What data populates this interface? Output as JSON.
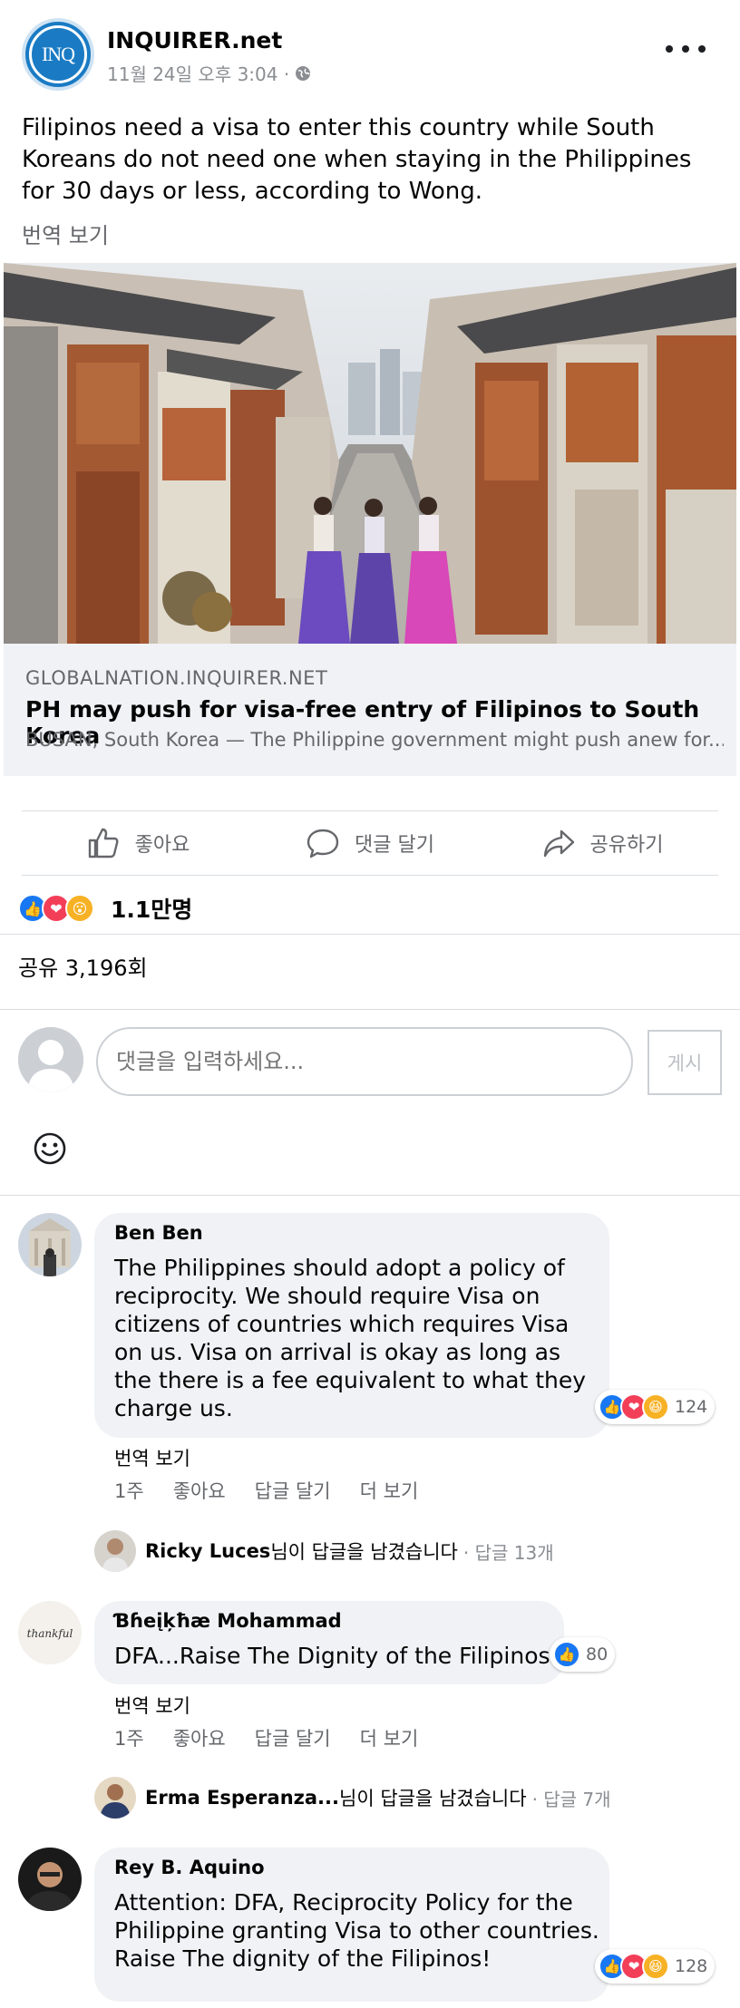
{
  "post": {
    "page_name": "INQUIRER.net",
    "logo_text": "INQ",
    "date": "11월 24일 오후 3:04 ·",
    "text": "Filipinos need a visa to enter this country while South Koreans do not need one when staying in the Philippines for 30 days or less, according to Wong.",
    "translate_label": "번역 보기"
  },
  "link": {
    "domain": "GLOBALNATION.INQUIRER.NET",
    "title": "PH may push for visa-free entry of Filipinos to South Korea",
    "description": "BUSAN, South Korea — The Philippine government might push anew for..."
  },
  "actions": {
    "like": "좋아요",
    "comment": "댓글 달기",
    "share": "공유하기"
  },
  "stats": {
    "reactions": "1.1만명",
    "shares": "공유 3,196회"
  },
  "composer": {
    "placeholder": "댓글을 입력하세요...",
    "post_label": "게시"
  },
  "comments": [
    {
      "author": "Ben Ben",
      "text": "The Philippines should adopt a policy of reciprocity. We should require Visa on citizens of countries which requires Visa on us. Visa on arrival is okay as long as the there is a fee equivalent to what they charge us.",
      "reaction_count": "124",
      "translate": "번역 보기",
      "time": "1주",
      "like": "좋아요",
      "reply": "답글 달기",
      "more": "더 보기",
      "reply_summary": {
        "name": "Ricky Luces",
        "text": "님이 답글을 남겼습니다",
        "meta": "· 답글 13개"
      }
    },
    {
      "author": "Ɓɦeįķħæ Mohammad",
      "text": "DFA...Raise The Dignity of the Filipinos!",
      "reaction_count": "80",
      "translate": "번역 보기",
      "time": "1주",
      "like": "좋아요",
      "reply": "답글 달기",
      "more": "더 보기",
      "avatar_text": "thankful",
      "reply_summary": {
        "name": "Erma Esperanza...",
        "text": "님이 답글을 남겼습니다",
        "meta": "· 답글 7개"
      }
    },
    {
      "author": "Rey B. Aquino",
      "text": "Attention: DFA, Reciprocity Policy for the Philippine granting Visa to other countries. Raise The dignity of the Filipinos!",
      "reaction_count": "128"
    }
  ],
  "colors": {
    "brand_blue": "#1877f2",
    "love_red": "#f33e58",
    "wow_yellow": "#f7b125",
    "muted_text": "#65676b",
    "bubble_bg": "#f0f2f5"
  }
}
